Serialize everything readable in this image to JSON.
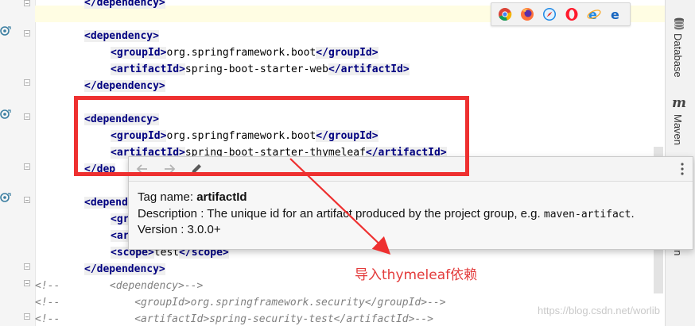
{
  "editor": {
    "lines": [
      {
        "id": "l0",
        "parts": [
          {
            "t": "tag",
            "v": "</dependency>"
          }
        ]
      },
      {
        "id": "l1",
        "parts": []
      },
      {
        "id": "l2",
        "parts": [
          {
            "t": "tag",
            "v": "<dependency>"
          }
        ]
      },
      {
        "id": "l3",
        "parts": [
          {
            "t": "tag",
            "v": "<groupId>"
          },
          {
            "t": "txt",
            "v": "org.springframework.boot"
          },
          {
            "t": "tag",
            "v": "</groupId>"
          }
        ]
      },
      {
        "id": "l4",
        "parts": [
          {
            "t": "tag",
            "v": "<artifactId>"
          },
          {
            "t": "txt",
            "v": "spring-boot-starter-web"
          },
          {
            "t": "tag",
            "v": "</artifactId>"
          }
        ]
      },
      {
        "id": "l5",
        "parts": [
          {
            "t": "tag",
            "v": "</dependency>"
          }
        ]
      },
      {
        "id": "l6",
        "parts": []
      },
      {
        "id": "l7",
        "parts": [
          {
            "t": "tag",
            "v": "<dependency>"
          }
        ]
      },
      {
        "id": "l8",
        "parts": [
          {
            "t": "tag",
            "v": "<groupId>"
          },
          {
            "t": "txt",
            "v": "org.springframework.boot"
          },
          {
            "t": "tag",
            "v": "</groupId>"
          }
        ]
      },
      {
        "id": "l9",
        "parts": [
          {
            "t": "tag",
            "v": "<artifactId>"
          },
          {
            "t": "txt",
            "v": "spring-boot-starter-thymeleaf"
          },
          {
            "t": "tag",
            "v": "</artifactId>"
          }
        ]
      },
      {
        "id": "l10",
        "parts": [
          {
            "t": "tag",
            "v": "</dep"
          }
        ]
      },
      {
        "id": "l11",
        "parts": []
      },
      {
        "id": "l12",
        "parts": [
          {
            "t": "tag",
            "v": "<depend"
          }
        ]
      },
      {
        "id": "l13",
        "parts": [
          {
            "t": "tag",
            "v": "<gr"
          }
        ]
      },
      {
        "id": "l14",
        "parts": [
          {
            "t": "tag",
            "v": "<ar"
          }
        ]
      },
      {
        "id": "l15",
        "parts": [
          {
            "t": "tag",
            "v": "<scope>"
          },
          {
            "t": "txt",
            "v": "test"
          },
          {
            "t": "tag",
            "v": "</scope>"
          }
        ]
      },
      {
        "id": "l16",
        "parts": [
          {
            "t": "tag",
            "v": "</dependency>"
          }
        ]
      },
      {
        "id": "l17",
        "parts": [
          {
            "t": "cmt",
            "v": "<!--        <dependency>-->"
          }
        ]
      },
      {
        "id": "l18",
        "parts": [
          {
            "t": "cmt",
            "v": "<!--            <groupId>org.springframework.security</groupId>-->"
          }
        ]
      },
      {
        "id": "l19",
        "parts": [
          {
            "t": "cmt",
            "v": "<!--            <artifactId>spring-security-test</artifactId>-->"
          }
        ]
      }
    ]
  },
  "browsers": [
    "chrome-icon",
    "firefox-icon",
    "safari-icon",
    "opera-icon",
    "internet-explorer-icon",
    "edge-icon"
  ],
  "right_panel": {
    "database_label": "Database",
    "maven_glyph": "m",
    "maven_label": "Maven",
    "hidden_label": "ion"
  },
  "popup": {
    "tag_name_label": "Tag name: ",
    "tag_name_value": "artifactId",
    "description_label": "Description : ",
    "description_text": "The unique id for an artifact produced by the project group, e.g. ",
    "description_code": "maven-artifact",
    "description_end": ".",
    "version_text": "Version : 3.0.0+"
  },
  "annotation": {
    "text": "导入thymeleaf依赖",
    "color": "#e33b3b"
  },
  "watermark": "https://blog.csdn.net/worlib",
  "colors": {
    "tag": "#000080",
    "tag_bg": "#efefef",
    "comment": "#808080",
    "highlight": "#ee3030"
  }
}
